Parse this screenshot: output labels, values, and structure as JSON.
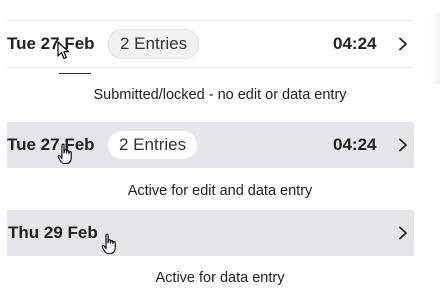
{
  "rows": [
    {
      "date": "Tue 27 Feb",
      "entries": "2 Entries",
      "time": "04:24",
      "caption": "Submitted/locked - no edit or data entry"
    },
    {
      "date": "Tue 27 Feb",
      "entries": "2 Entries",
      "time": "04:24",
      "caption": "Active for edit and data entry"
    },
    {
      "date": "Thu 29 Feb",
      "caption": "Active for data entry"
    }
  ],
  "icons": {
    "chevron": "chevron-right-icon",
    "arrow_cursor": "arrow-cursor-icon",
    "hand_cursor": "hand-pointer-icon"
  },
  "colors": {
    "white_row_bg": "#ffffff",
    "grey_row_bg": "#e6e6ea",
    "badge_grey": "#f2f2f4",
    "text": "#222222"
  }
}
